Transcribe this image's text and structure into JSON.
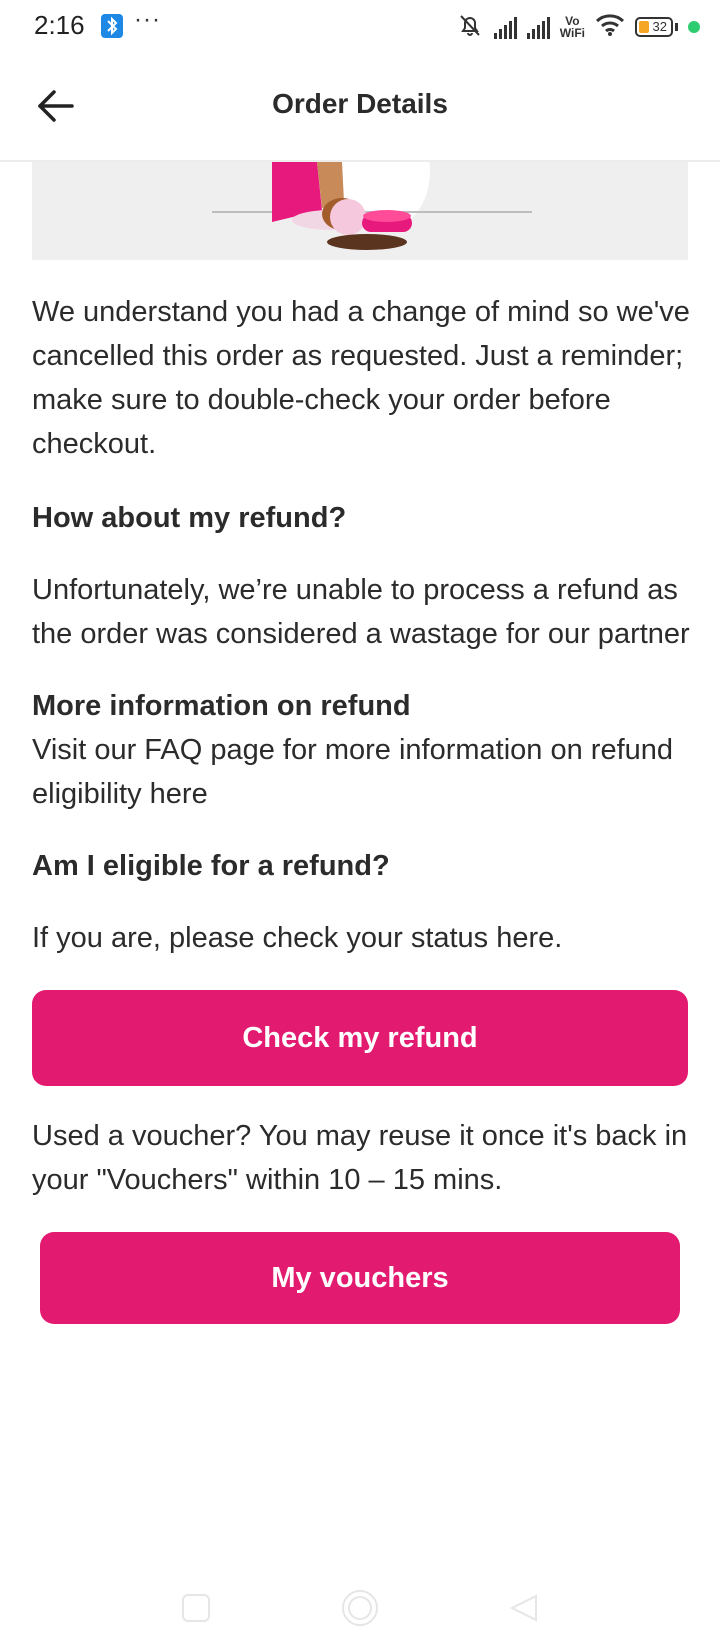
{
  "status_bar": {
    "time": "2:16",
    "more": "···",
    "network_label_top": "Vo",
    "network_label_bottom": "WiFi",
    "battery": "32",
    "colors": {
      "bluetooth": "#1e88e5",
      "battery_fill": "#f5a623",
      "dot": "#2ecc71"
    }
  },
  "header": {
    "title": "Order Details",
    "back_icon": "arrow-left-icon"
  },
  "content": {
    "intro": "We understand you had a change of mind so we've cancelled this order as requested. Just a reminder; make sure to double-check your order before checkout.",
    "refund_heading": "How about my refund?",
    "refund_text": "Unfortunately, we’re unable to process a refund as the order was considered a wastage for our partner",
    "more_info_heading": "More information on refund",
    "more_info_text": "Visit our FAQ page for more information on refund eligibility here",
    "eligible_heading": "Am I eligible for a refund?",
    "eligible_text": "If you are, please check your status here.",
    "check_refund_button": "Check my refund",
    "voucher_text": "Used a voucher? You may reuse it once it's back in your \"Vouchers\" within 10 – 15 mins.",
    "vouchers_button": "My vouchers"
  },
  "theme": {
    "accent": "#e21b70",
    "text": "#2b2b2b"
  },
  "nav_bar": {
    "icons": [
      "recent-apps-icon",
      "home-icon",
      "back-triangle-icon"
    ]
  }
}
